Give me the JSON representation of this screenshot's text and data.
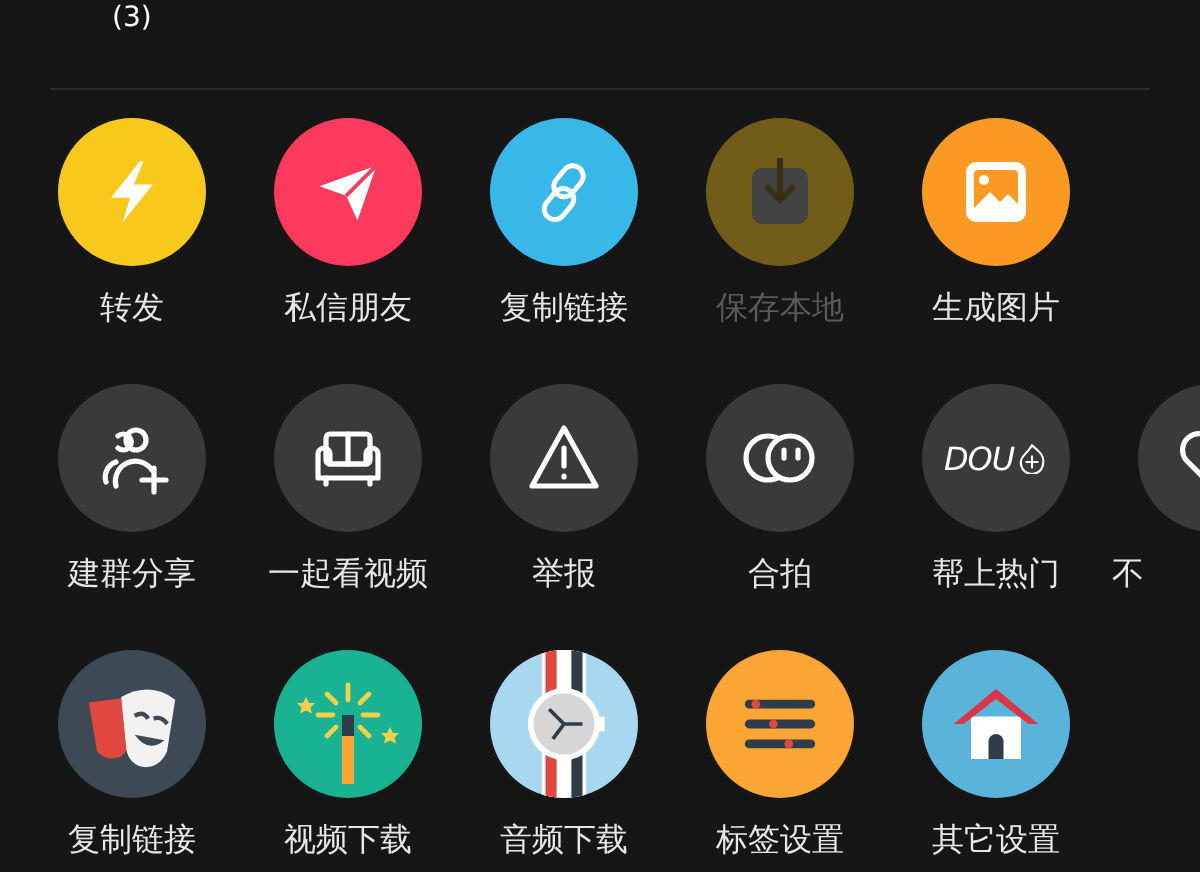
{
  "header": {
    "count": "(3)"
  },
  "rows": [
    {
      "items": [
        {
          "label": "转发",
          "disabled": false
        },
        {
          "label": "私信朋友",
          "disabled": false
        },
        {
          "label": "复制链接",
          "disabled": false
        },
        {
          "label": "保存本地",
          "disabled": true
        },
        {
          "label": "生成图片",
          "disabled": false
        }
      ]
    },
    {
      "items": [
        {
          "label": "建群分享",
          "disabled": false
        },
        {
          "label": "一起看视频",
          "disabled": false
        },
        {
          "label": "举报",
          "disabled": false
        },
        {
          "label": "合拍",
          "disabled": false
        },
        {
          "label": "帮上热门",
          "disabled": false,
          "icon_text": "DOU"
        },
        {
          "label": "不",
          "disabled": false
        }
      ]
    },
    {
      "items": [
        {
          "label": "复制链接",
          "disabled": false
        },
        {
          "label": "视频下载",
          "disabled": false
        },
        {
          "label": "音频下载",
          "disabled": false
        },
        {
          "label": "标签设置",
          "disabled": false
        },
        {
          "label": "其它设置",
          "disabled": false
        }
      ]
    }
  ]
}
